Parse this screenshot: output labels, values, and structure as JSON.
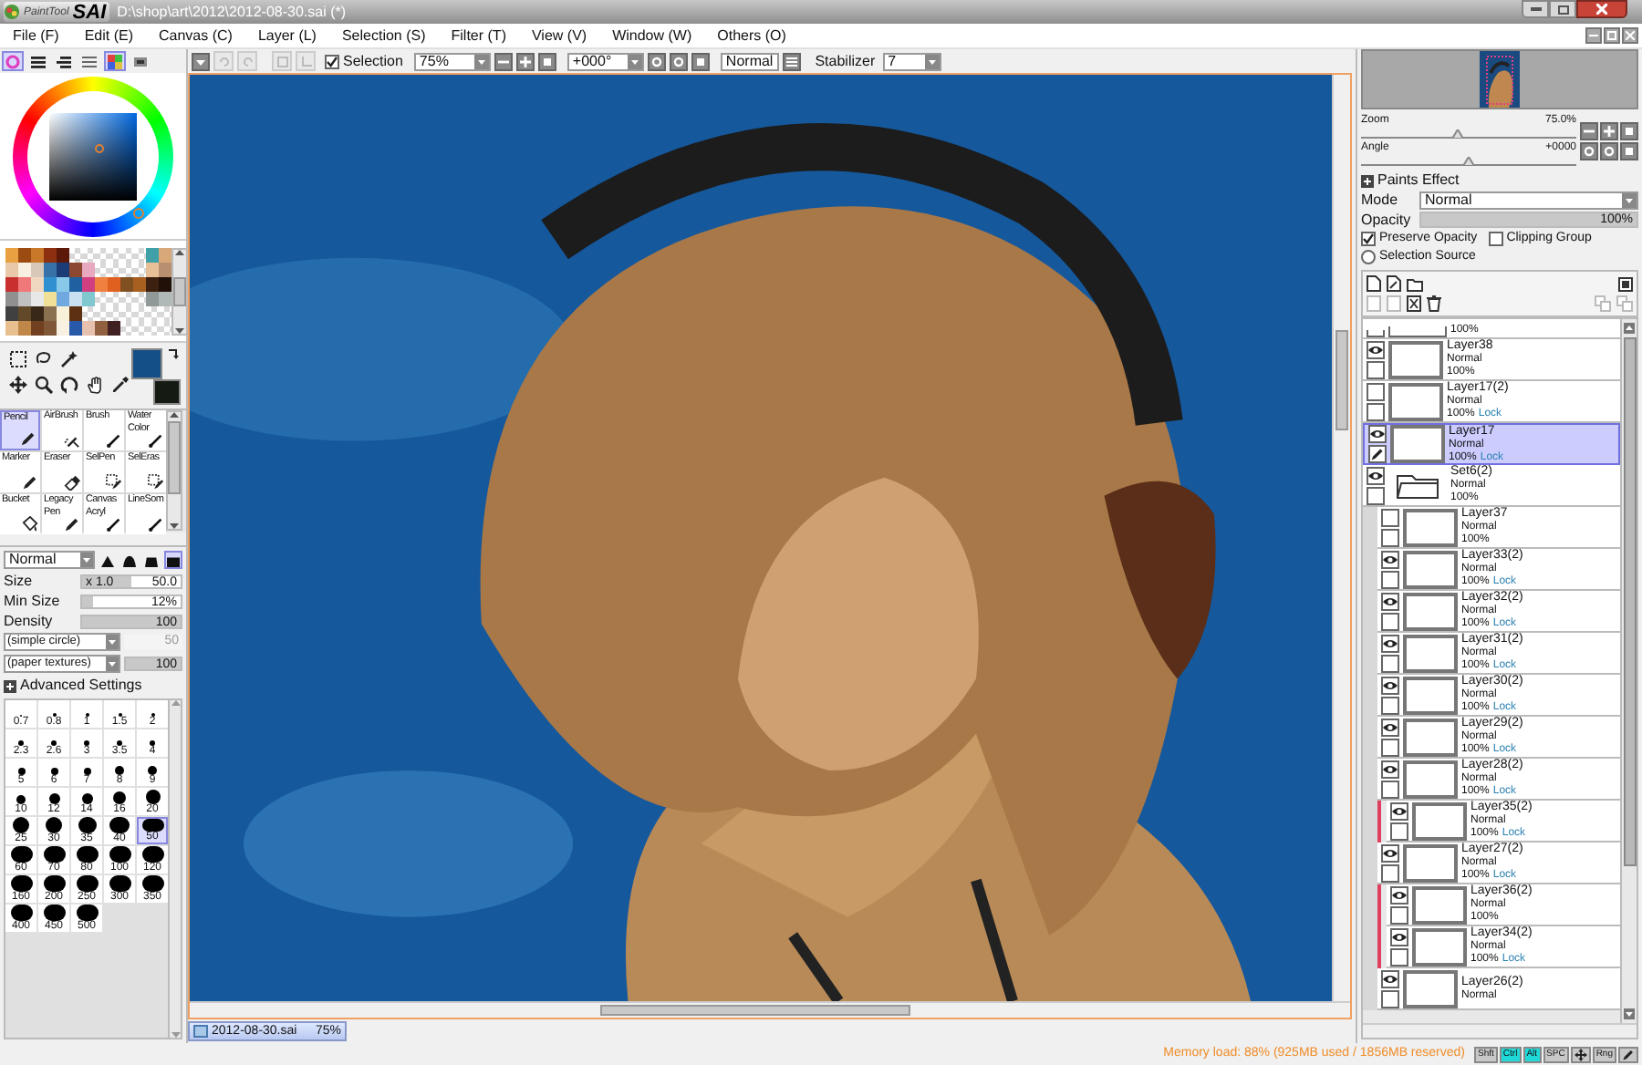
{
  "title_bar": {
    "app_name_small": "PaintTool",
    "app_name": "SAI",
    "title": "D:\\shop\\art\\2012\\2012-08-30.sai (*)"
  },
  "menu": [
    "File (F)",
    "Edit (E)",
    "Canvas (C)",
    "Layer (L)",
    "Selection (S)",
    "Filter (T)",
    "View (V)",
    "Window (W)",
    "Others (O)"
  ],
  "color_modes": [
    {
      "kind": "wheel",
      "selected": true
    },
    {
      "kind": "rgb",
      "selected": false
    },
    {
      "kind": "hsv",
      "selected": false
    },
    {
      "kind": "mixer",
      "selected": false
    },
    {
      "kind": "swatch",
      "selected": true
    },
    {
      "kind": "scratch",
      "selected": false
    }
  ],
  "canvas_toolbar": {
    "selection": {
      "label": "Selection",
      "checked": true
    },
    "zoom": "75%",
    "angle": "+000°",
    "mode_button": "Normal",
    "stabilizer_label": "Stabilizer",
    "stabilizer": "7"
  },
  "current_colors": [
    {
      "kind": "primary",
      "color": "#154f88"
    },
    {
      "kind": "secondary",
      "color": "#151a12"
    }
  ],
  "swatches": [
    {
      "color": "#e8a040"
    },
    {
      "color": "#9c4c10"
    },
    {
      "color": "#c87828"
    },
    {
      "color": "#8c3010"
    },
    {
      "color": "#5c1808"
    },
    {
      "kind": "empty"
    },
    {
      "kind": "empty"
    },
    {
      "kind": "empty"
    },
    {
      "kind": "empty"
    },
    {
      "kind": "empty"
    },
    {
      "kind": "empty"
    },
    {
      "color": "#40a0a8"
    },
    {
      "color": "#d8a878"
    },
    {
      "color": "#e8c8a8"
    },
    {
      "color": "#f8f0e0"
    },
    {
      "color": "#d8c8b8"
    },
    {
      "color": "#3870a8"
    },
    {
      "color": "#1c3c78"
    },
    {
      "color": "#8c4830"
    },
    {
      "color": "#e8a8c0"
    },
    {
      "kind": "empty"
    },
    {
      "kind": "empty"
    },
    {
      "kind": "empty"
    },
    {
      "kind": "empty"
    },
    {
      "color": "#e8c098"
    },
    {
      "color": "#b89070"
    },
    {
      "color": "#c83030"
    },
    {
      "color": "#f07878"
    },
    {
      "color": "#f0d8c0"
    },
    {
      "color": "#3090d0"
    },
    {
      "color": "#88c8e8"
    },
    {
      "color": "#2060a0"
    },
    {
      "color": "#d04080"
    },
    {
      "color": "#f08040"
    },
    {
      "color": "#e06020"
    },
    {
      "color": "#805020"
    },
    {
      "color": "#a86020"
    },
    {
      "color": "#3c2010"
    },
    {
      "color": "#201008"
    },
    {
      "color": "#909090"
    },
    {
      "color": "#c0c0c0"
    },
    {
      "color": "#e8e8e8"
    },
    {
      "color": "#f0e098"
    },
    {
      "color": "#70a8e0"
    },
    {
      "color": "#c8e0f0"
    },
    {
      "color": "#80c8d0"
    },
    {
      "kind": "empty"
    },
    {
      "kind": "empty"
    },
    {
      "kind": "empty"
    },
    {
      "kind": "empty"
    },
    {
      "color": "#909898"
    },
    {
      "color": "#b0b8b8"
    },
    {
      "color": "#404040"
    },
    {
      "color": "#604828"
    },
    {
      "color": "#382818"
    },
    {
      "color": "#887050"
    },
    {
      "color": "#f8f0d8"
    },
    {
      "color": "#5c3010"
    },
    {
      "kind": "empty"
    },
    {
      "kind": "empty"
    },
    {
      "kind": "empty"
    },
    {
      "kind": "empty"
    },
    {
      "kind": "empty"
    },
    {
      "kind": "empty"
    },
    {
      "kind": "empty"
    },
    {
      "color": "#e8c090"
    },
    {
      "color": "#c08848"
    },
    {
      "color": "#704020"
    },
    {
      "color": "#805838"
    },
    {
      "color": "#f8f0e0"
    },
    {
      "color": "#2858a8"
    },
    {
      "color": "#e8c0b0"
    },
    {
      "color": "#906040"
    },
    {
      "color": "#402020"
    },
    {
      "kind": "empty"
    },
    {
      "kind": "empty"
    },
    {
      "kind": "empty"
    },
    {
      "kind": "empty"
    }
  ],
  "tools": [
    {
      "label": "Pencil",
      "kind": "pencil",
      "selected": true
    },
    {
      "label": "AirBrush",
      "kind": "airbrush",
      "selected": false
    },
    {
      "label": "Brush",
      "kind": "brush",
      "selected": false
    },
    {
      "label": "Water Color",
      "kind": "brush",
      "selected": false
    },
    {
      "label": "Marker",
      "kind": "pencil",
      "selected": false
    },
    {
      "label": "Eraser",
      "kind": "eraser",
      "selected": false
    },
    {
      "label": "SelPen",
      "kind": "selpen",
      "selected": false
    },
    {
      "label": "SelEras",
      "kind": "selpen",
      "selected": false
    },
    {
      "label": "Bucket",
      "kind": "bucket",
      "selected": false
    },
    {
      "label": "Legacy Pen",
      "kind": "pencil",
      "selected": false
    },
    {
      "label": "Canvas Acryl",
      "kind": "brush",
      "selected": false
    },
    {
      "label": "LineSom",
      "kind": "brush",
      "selected": false
    }
  ],
  "brush": {
    "mode": "Normal",
    "tip_shapes": [
      {
        "selected": false
      },
      {
        "selected": false
      },
      {
        "selected": false
      },
      {
        "selected": true
      }
    ],
    "sliders": [
      {
        "label": "Size",
        "prefix": "x 1.0",
        "value": "50.0",
        "level": 0.5
      },
      {
        "label": "Min Size",
        "value": "12%",
        "level": 0.12
      },
      {
        "label": "Density",
        "value": "100",
        "level": 1
      }
    ],
    "shape": {
      "value": "(simple circle)",
      "amount": "50",
      "disabled": true
    },
    "texture": {
      "value": "(paper textures)",
      "amount": "100",
      "level": 1
    },
    "advanced": "Advanced Settings"
  },
  "brush_sizes": [
    {
      "label": "0.7",
      "selected": false
    },
    {
      "label": "0.8",
      "selected": false
    },
    {
      "label": "1",
      "selected": false
    },
    {
      "label": "1.5",
      "selected": false
    },
    {
      "label": "2",
      "selected": false
    },
    {
      "label": "2.3",
      "selected": false
    },
    {
      "label": "2.6",
      "selected": false
    },
    {
      "label": "3",
      "selected": false
    },
    {
      "label": "3.5",
      "selected": false
    },
    {
      "label": "4",
      "selected": false
    },
    {
      "label": "5",
      "selected": false
    },
    {
      "label": "6",
      "selected": false
    },
    {
      "label": "7",
      "selected": false
    },
    {
      "label": "8",
      "selected": false
    },
    {
      "label": "9",
      "selected": false
    },
    {
      "label": "10",
      "selected": false
    },
    {
      "label": "12",
      "selected": false
    },
    {
      "label": "14",
      "selected": false
    },
    {
      "label": "16",
      "selected": false
    },
    {
      "label": "20",
      "selected": false
    },
    {
      "label": "25",
      "selected": false
    },
    {
      "label": "30",
      "selected": false
    },
    {
      "label": "35",
      "selected": false
    },
    {
      "label": "40",
      "selected": false
    },
    {
      "label": "50",
      "selected": true
    },
    {
      "label": "60",
      "selected": false
    },
    {
      "label": "70",
      "selected": false
    },
    {
      "label": "80",
      "selected": false
    },
    {
      "label": "100",
      "selected": false
    },
    {
      "label": "120",
      "selected": false
    },
    {
      "label": "160",
      "selected": false
    },
    {
      "label": "200",
      "selected": false
    },
    {
      "label": "250",
      "selected": false
    },
    {
      "label": "300",
      "selected": false
    },
    {
      "label": "350",
      "selected": false
    },
    {
      "label": "400",
      "selected": false
    },
    {
      "label": "450",
      "selected": false
    },
    {
      "label": "500",
      "selected": false
    }
  ],
  "navigator": {
    "zoom": {
      "label": "Zoom",
      "value": "75.0%",
      "level": 0.45
    },
    "angle": {
      "label": "Angle",
      "value": "+0000",
      "level": 0.5
    }
  },
  "layer_panel": {
    "paints_effect": "Paints Effect",
    "mode_label": "Mode",
    "mode": "Normal",
    "opacity": {
      "label": "Opacity",
      "value": "100%",
      "level": 1
    },
    "preserve_opacity": {
      "label": "Preserve Opacity",
      "checked": true
    },
    "clipping_group": {
      "label": "Clipping Group",
      "checked": false
    },
    "selection_source": {
      "label": "Selection Source",
      "selected": false
    }
  },
  "layers": [
    {
      "kind": "partial",
      "opacity": "100%"
    },
    {
      "kind": "layer",
      "name": "Layer38",
      "mode": "Normal",
      "opacity": "100%",
      "visible": true,
      "selected": false
    },
    {
      "kind": "layer",
      "name": "Layer17(2)",
      "mode": "Normal",
      "opacity": "100%",
      "lock": "Lock",
      "visible": false,
      "selected": false
    },
    {
      "kind": "layer",
      "name": "Layer17",
      "mode": "Normal",
      "opacity": "100%",
      "lock": "Lock",
      "visible": true,
      "selected": true
    },
    {
      "kind": "folder",
      "name": "Set6(2)",
      "mode": "Normal",
      "opacity": "100%",
      "visible": true,
      "selected": false,
      "children": [
        {
          "kind": "layer",
          "name": "Layer37",
          "mode": "Normal",
          "opacity": "100%",
          "visible": false,
          "selected": false
        },
        {
          "kind": "layer",
          "name": "Layer33(2)",
          "mode": "Normal",
          "opacity": "100%",
          "lock": "Lock",
          "visible": true,
          "selected": false
        },
        {
          "kind": "layer",
          "name": "Layer32(2)",
          "mode": "Normal",
          "opacity": "100%",
          "lock": "Lock",
          "visible": true,
          "selected": false
        },
        {
          "kind": "layer",
          "name": "Layer31(2)",
          "mode": "Normal",
          "opacity": "100%",
          "lock": "Lock",
          "visible": true,
          "selected": false
        },
        {
          "kind": "layer",
          "name": "Layer30(2)",
          "mode": "Normal",
          "opacity": "100%",
          "lock": "Lock",
          "visible": true,
          "selected": false
        },
        {
          "kind": "layer",
          "name": "Layer29(2)",
          "mode": "Normal",
          "opacity": "100%",
          "lock": "Lock",
          "visible": true,
          "selected": false
        },
        {
          "kind": "layer",
          "name": "Layer28(2)",
          "mode": "Normal",
          "opacity": "100%",
          "lock": "Lock",
          "visible": true,
          "selected": false
        },
        {
          "kind": "layer",
          "name": "Layer35(2)",
          "mode": "Normal",
          "opacity": "100%",
          "lock": "Lock",
          "visible": true,
          "selected": false,
          "clipping": true
        },
        {
          "kind": "layer",
          "name": "Layer27(2)",
          "mode": "Normal",
          "opacity": "100%",
          "lock": "Lock",
          "visible": true,
          "selected": false
        },
        {
          "kind": "layer",
          "name": "Layer36(2)",
          "mode": "Normal",
          "opacity": "100%",
          "visible": true,
          "selected": false,
          "clipping": true
        },
        {
          "kind": "layer",
          "name": "Layer34(2)",
          "mode": "Normal",
          "opacity": "100%",
          "lock": "Lock",
          "visible": true,
          "selected": false,
          "clipping": true
        },
        {
          "kind": "layer",
          "name": "Layer26(2)",
          "mode": "Normal",
          "visible": true,
          "selected": false
        }
      ]
    }
  ],
  "document_tab": {
    "name": "2012-08-30.sai",
    "zoom": "75%"
  },
  "status_bar": {
    "memory": "Memory load: 88% (925MB used / 1856MB reserved)",
    "keys": [
      {
        "kind": "text",
        "label": "Shft",
        "on": false
      },
      {
        "kind": "text",
        "label": "Ctrl",
        "on": true
      },
      {
        "kind": "text",
        "label": "Alt",
        "on": true
      },
      {
        "kind": "text",
        "label": "SPC",
        "on": false
      },
      {
        "kind": "move",
        "on": false
      },
      {
        "kind": "text",
        "label": "Rng",
        "on": false
      },
      {
        "kind": "pen",
        "on": false
      }
    ]
  }
}
